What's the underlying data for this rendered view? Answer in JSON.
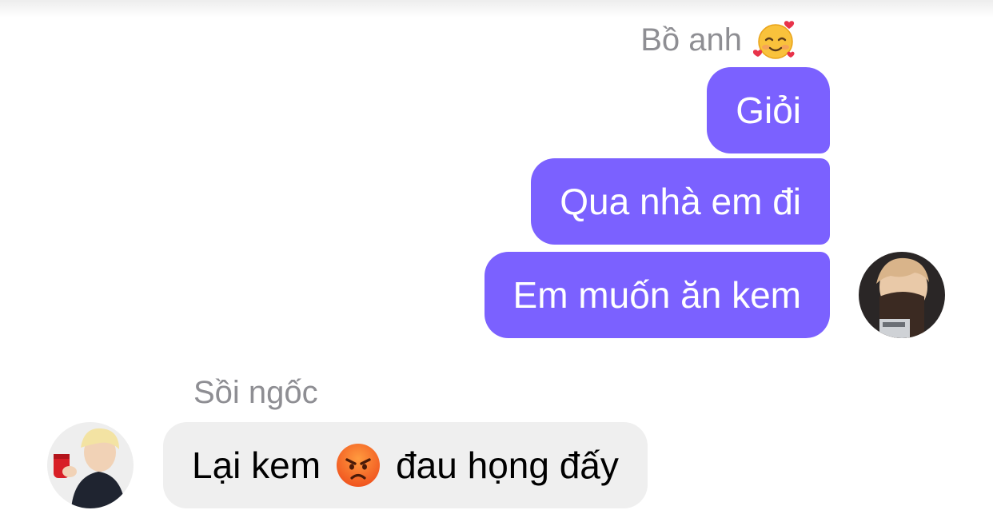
{
  "conversation": {
    "outgoing_sender": {
      "name": "Bồ anh",
      "emoji": "smiling-face-with-hearts"
    },
    "outgoing_messages": [
      {
        "text": "Giỏi"
      },
      {
        "text": "Qua nhà em đi"
      },
      {
        "text": "Em muốn ăn kem"
      }
    ],
    "incoming_sender": {
      "name": "Sồi ngốc"
    },
    "incoming_message": {
      "text_before": "Lại kem",
      "emoji": "angry-face",
      "text_after": "đau họng đấy"
    }
  },
  "colors": {
    "outgoing_bubble": "#7b61ff",
    "incoming_bubble": "#efefef",
    "sender_name": "#8e8e93"
  }
}
